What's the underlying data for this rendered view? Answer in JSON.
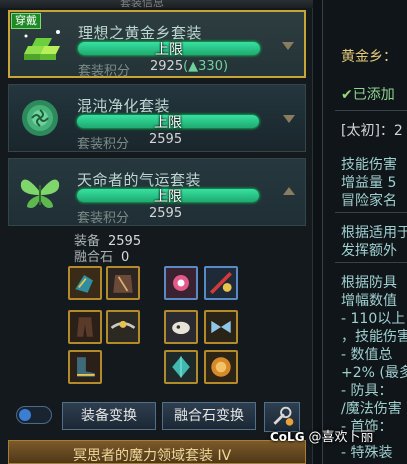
{
  "panel_title": "套装信息",
  "sets": [
    {
      "name": "理想之黄金乡套装",
      "badge": "穿戴",
      "bar_text": "上限",
      "score_label": "套装积分",
      "score": "2925",
      "bonus": "(▲330)"
    },
    {
      "name": "混沌净化套装",
      "bar_text": "上限",
      "score_label": "套装积分",
      "score": "2595"
    },
    {
      "name": "天命者的气运套装",
      "bar_text": "上限",
      "score_label": "套装积分",
      "score": "2595"
    }
  ],
  "detail": {
    "equip_label": "装备",
    "equip_value": "2595",
    "fusion_label": "融合石",
    "fusion_value": "0"
  },
  "buttons": {
    "equip_change": "装备变换",
    "fusion_change": "融合石变换"
  },
  "bottom_set": "冥思者的魔力领域套装 IV",
  "right_text": {
    "line1": "黄金乡：",
    "line2": "已添加",
    "line3": "[太初]：2",
    "line4": "技能伤害",
    "line5": "增益量 5",
    "line6": "冒险家名",
    "line7": "根据适用于",
    "line8": "发挥额外",
    "line9": "根据防具",
    "line10": "增幅数值",
    "line11": "- 110以上",
    "line12": "，技能伤害",
    "line13": "- 数值总",
    "line14": "+2% (最多",
    "line15": "- 防具：",
    "line16": "/魔法伤害",
    "line17": "- 首饰：",
    "line18": "- 特殊装"
  },
  "watermark": {
    "brand": "CoLG",
    "text": "@喜欢卜丽"
  },
  "colors": {
    "bar_green": "#2fd08f",
    "equipped_border": "#c9a437",
    "badge_green": "#1d8a26"
  }
}
